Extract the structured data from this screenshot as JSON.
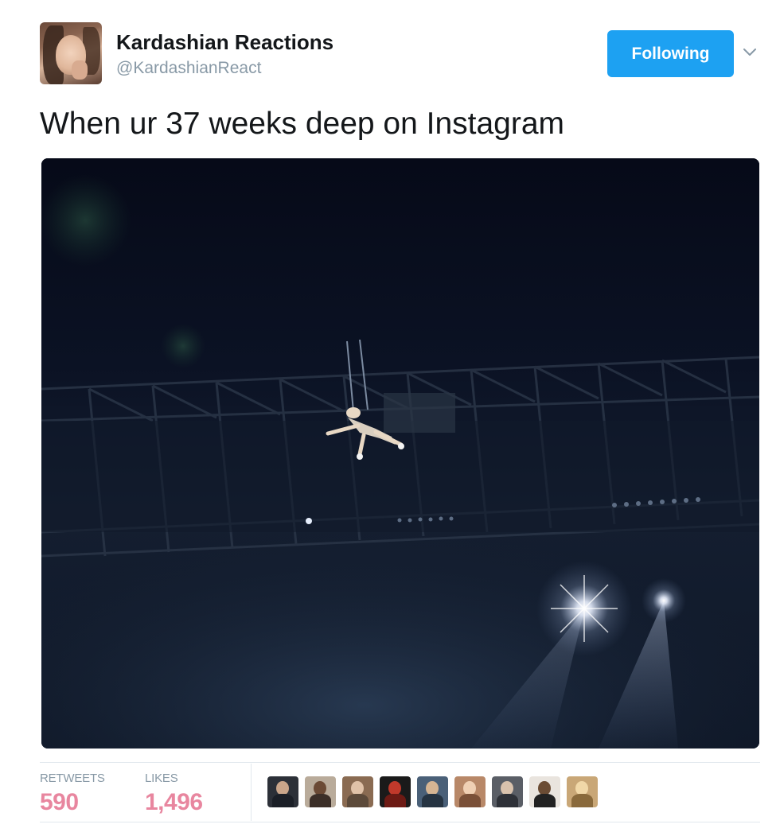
{
  "tweet": {
    "author": {
      "display_name": "Kardashian Reactions",
      "handle": "@KardashianReact",
      "avatar_icon": "user-avatar"
    },
    "follow_button": {
      "label": "Following",
      "color": "#1da1f2"
    },
    "menu_icon": "chevron-down-icon",
    "text": "When ur 37 weeks deep on Instagram",
    "media": {
      "type": "image",
      "description_icon": "photo"
    },
    "stats": {
      "retweets_label": "RETWEETS",
      "retweets_value": "590",
      "likes_label": "LIKES",
      "likes_value": "1,496",
      "value_color": "#e8869f"
    },
    "likers": [
      {
        "icon": "liker-avatar-1"
      },
      {
        "icon": "liker-avatar-2"
      },
      {
        "icon": "liker-avatar-3"
      },
      {
        "icon": "liker-avatar-4"
      },
      {
        "icon": "liker-avatar-5"
      },
      {
        "icon": "liker-avatar-6"
      },
      {
        "icon": "liker-avatar-7"
      },
      {
        "icon": "liker-avatar-8"
      },
      {
        "icon": "liker-avatar-9"
      }
    ]
  }
}
